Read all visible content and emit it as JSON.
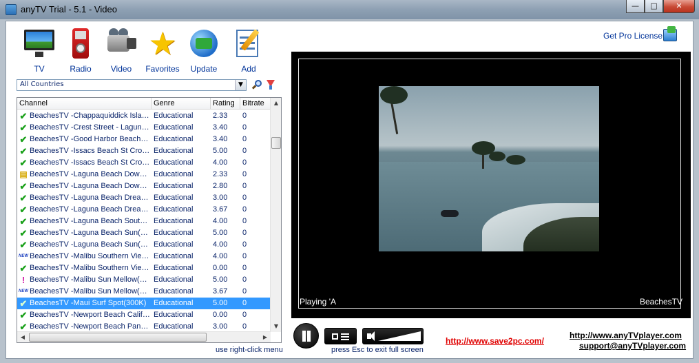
{
  "window": {
    "title": "anyTV Trial - 5.1 - Video",
    "minimize_glyph": "—",
    "maximize_glyph": "□",
    "close_glyph": "✕"
  },
  "toolbar": {
    "items": [
      {
        "label": "TV",
        "icon": "tv-icon"
      },
      {
        "label": "Radio",
        "icon": "ipod-icon"
      },
      {
        "label": "Video",
        "icon": "camcorder-icon"
      },
      {
        "label": "Favorites",
        "icon": "star-icon"
      },
      {
        "label": "Update",
        "icon": "globe-update-icon"
      },
      {
        "label": "Add",
        "icon": "edit-document-icon"
      }
    ],
    "star_glyph": "★"
  },
  "pro_license": {
    "label": "Get Pro License"
  },
  "country_filter": {
    "selected": "All Countries",
    "dropdown_glyph": "▼"
  },
  "table": {
    "columns": [
      "Channel",
      "Genre",
      "Rating",
      "Bitrate"
    ],
    "rows": [
      {
        "status": "check",
        "channel": "BeachesTV -Chappaquiddick Islan…",
        "genre": "Educational",
        "rating": "2.33",
        "bitrate": "0"
      },
      {
        "status": "check",
        "channel": "BeachesTV -Crest Street - Lagun…",
        "genre": "Educational",
        "rating": "3.40",
        "bitrate": "0"
      },
      {
        "status": "check",
        "channel": "BeachesTV -Good Harbor Beach(…",
        "genre": "Educational",
        "rating": "3.40",
        "bitrate": "0"
      },
      {
        "status": "check",
        "channel": "BeachesTV -Issacs Beach St Croi…",
        "genre": "Educational",
        "rating": "5.00",
        "bitrate": "0"
      },
      {
        "status": "check",
        "channel": "BeachesTV -Issacs Beach St Croi…",
        "genre": "Educational",
        "rating": "4.00",
        "bitrate": "0"
      },
      {
        "status": "note",
        "channel": "BeachesTV -Laguna Beach Downt…",
        "genre": "Educational",
        "rating": "2.33",
        "bitrate": "0"
      },
      {
        "status": "check",
        "channel": "BeachesTV -Laguna Beach Downt…",
        "genre": "Educational",
        "rating": "2.80",
        "bitrate": "0"
      },
      {
        "status": "check",
        "channel": "BeachesTV -Laguna Beach Dream…",
        "genre": "Educational",
        "rating": "3.00",
        "bitrate": "0"
      },
      {
        "status": "check",
        "channel": "BeachesTV -Laguna Beach Dream…",
        "genre": "Educational",
        "rating": "3.67",
        "bitrate": "0"
      },
      {
        "status": "check",
        "channel": "BeachesTV -Laguna Beach South…",
        "genre": "Educational",
        "rating": "4.00",
        "bitrate": "0"
      },
      {
        "status": "check",
        "channel": "BeachesTV -Laguna Beach Sun(1…",
        "genre": "Educational",
        "rating": "5.00",
        "bitrate": "0"
      },
      {
        "status": "check",
        "channel": "BeachesTV -Laguna Beach Sun(3…",
        "genre": "Educational",
        "rating": "4.00",
        "bitrate": "0"
      },
      {
        "status": "new",
        "channel": "BeachesTV -Malibu Southern Vie…",
        "genre": "Educational",
        "rating": "4.00",
        "bitrate": "0"
      },
      {
        "status": "check",
        "channel": "BeachesTV -Malibu Southern Vie…",
        "genre": "Educational",
        "rating": "0.00",
        "bitrate": "0"
      },
      {
        "status": "warn",
        "channel": "BeachesTV -Malibu Sun Mellow(1…",
        "genre": "Educational",
        "rating": "5.00",
        "bitrate": "0"
      },
      {
        "status": "new",
        "channel": "BeachesTV -Malibu Sun Mellow(3…",
        "genre": "Educational",
        "rating": "3.67",
        "bitrate": "0"
      },
      {
        "status": "check",
        "channel": "BeachesTV -Maui Surf Spot(300K)",
        "genre": "Educational",
        "rating": "5.00",
        "bitrate": "0",
        "selected": true
      },
      {
        "status": "check",
        "channel": "BeachesTV -Newport Beach Calif…",
        "genre": "Educational",
        "rating": "0.00",
        "bitrate": "0"
      },
      {
        "status": "check",
        "channel": "BeachesTV -Newport Beach Pan(…",
        "genre": "Educational",
        "rating": "3.00",
        "bitrate": "0"
      }
    ],
    "status_glyphs": {
      "check": "✔",
      "new": "NEW",
      "warn": "!",
      "note": "▤"
    },
    "hint": "use right-click menu"
  },
  "player": {
    "status_left": "Playing 'A",
    "status_right": "BeachesTV",
    "esc_hint": "press Esc to exit full screen",
    "volume_level": 1.0
  },
  "links": {
    "save2pc": "http://www.save2pc.com/",
    "website": "http://www.anyTVplayer.com",
    "support": "support@anyTVplayer.com"
  },
  "colors": {
    "link_red": "#e00000",
    "label_blue": "#003399",
    "selection": "#3399ff",
    "check_green": "#19a019"
  }
}
